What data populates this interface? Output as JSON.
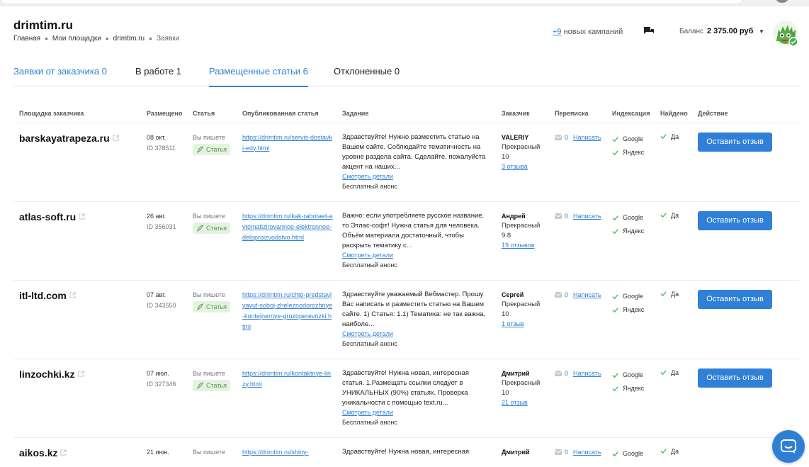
{
  "header": {
    "title": "drimtim.ru",
    "breadcrumb": [
      "Главная",
      "Мои площадки",
      "drimtim.ru",
      "Заявки"
    ],
    "campaigns_count": "+9",
    "campaigns_text": " новых кампаний",
    "balance_label": "Баланс",
    "balance_value": "2 375.00 руб"
  },
  "tabs": [
    {
      "label": "Заявки от заказчика 0"
    },
    {
      "label": "В работе 1"
    },
    {
      "label": "Размещенные статьи 6"
    },
    {
      "label": "Отклоненные 0"
    }
  ],
  "table": {
    "headers": [
      "Площадка заказчика",
      "Размещено",
      "Статья",
      "Опубликованная статья",
      "Задание",
      "Заказчик",
      "Переписка",
      "Индексация",
      "Найдено",
      "Действие"
    ],
    "writer_label": "Вы пишете",
    "badge_label": "Статья",
    "task_more": "Смотреть детали",
    "task_anons": "Бесплатный анонс",
    "write_label": "Написать",
    "index_google": "Google",
    "index_yandex": "Яндекс",
    "found_label": "Да",
    "action_label": "Оставить отзыв",
    "rows": [
      {
        "domain": "barskayatrapeza.ru",
        "date": "08 окт.",
        "id": "ID 378511",
        "link": "https://drimtim.ru/servis-dostavki-edy.html",
        "task": "Здравствуйте! Нужно разместить статью на Вашем сайте. Соблюдайте тематичность на уровне раздела сайта. Сделайте, пожалуйста акцент на наших...",
        "customer": "VALERIY",
        "rating": "Прекрасный 10",
        "reviews": "3 отзыва",
        "messages": "0"
      },
      {
        "domain": "atlas-soft.ru",
        "date": "26 авг.",
        "id": "ID 356031",
        "link": "https://drimtim.ru/kak-rabotaet-avtomatizirovannoe-elektronnoe-deloproizvodstvo.html",
        "task": "Важно: если употребляете русское название, то Этлас-софт! Нужна статья для человека. Объём материала достаточный, чтобы раскрыть тематику с...",
        "customer": "Андрей",
        "rating": "Прекрасный 9.8",
        "reviews": "19 отзывов",
        "messages": "0"
      },
      {
        "domain": "itl-ltd.com",
        "date": "07 авг.",
        "id": "ID 343550",
        "link": "https://drimtim.ru/chto-predstavlyayut-soboj-zheleznodorozhnye-kontejnernye-gruzoperevozki.html",
        "task": "Здравствуйте уважаемый Вебмастер. Прошу Вас написать и разместить статью на Вашем сайте. 1) Статья: 1.1) Тематика: не так важна, наиболе...",
        "customer": "Сергей",
        "rating": "Прекрасный 10",
        "reviews": "1 отзыв",
        "messages": "0"
      },
      {
        "domain": "linzochki.kz",
        "date": "07 июл.",
        "id": "ID 327346",
        "link": "https://drimtim.ru/kontaktnye-linzy.html",
        "task": "Здравствуйте! Нужна новая, интересная статья. 1.Размещать ссылки следует в УНИКАЛЬНЫХ (90%) статьях. Проверка уникальности с помощью text.ru...",
        "customer": "Дмитрий",
        "rating": "Прекрасный 10",
        "reviews": "21 отзыв",
        "messages": "0"
      },
      {
        "domain": "aikos.kz",
        "date": "21 июн.",
        "link": "https://drimtim.ru/shiny-",
        "task": "Здравствуйте! Нужна новая, интересная",
        "customer": "Дмитрий",
        "messages": "0"
      }
    ]
  }
}
